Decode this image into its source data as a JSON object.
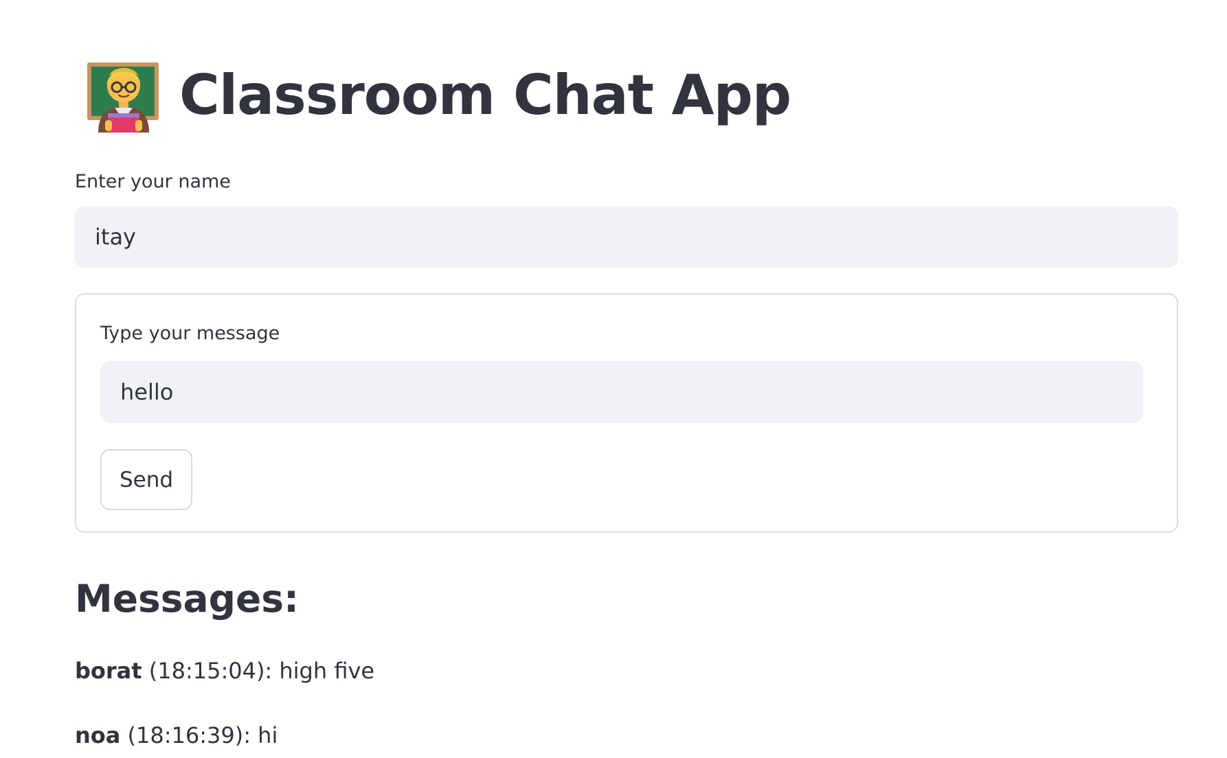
{
  "header": {
    "title": "Classroom Chat App",
    "icon": "teacher-emoji-icon"
  },
  "name_field": {
    "label": "Enter your name",
    "value": "itay"
  },
  "message_form": {
    "label": "Type your message",
    "value": "hello",
    "send_label": "Send"
  },
  "messages": {
    "heading": "Messages:",
    "items": [
      {
        "author": "borat",
        "meta": " (18:15:04): high five"
      },
      {
        "author": "noa",
        "meta": " (18:16:39): hi"
      }
    ]
  },
  "colors": {
    "text": "#31333f",
    "input_bg": "#f0f2f6",
    "border": "#d9dbe0",
    "background": "#ffffff"
  }
}
